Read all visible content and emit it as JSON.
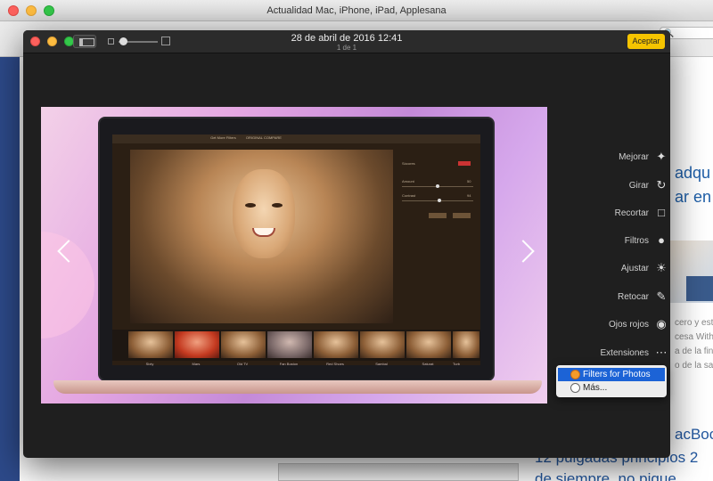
{
  "background_window": {
    "title": "Actualidad Mac, iPhone, iPad, Applesana",
    "right_snippets": [
      "adqu",
      "ar en l"
    ],
    "small_lines": [
      "cero y est",
      "cesa With",
      "a de la fin",
      "o de la sa"
    ],
    "bottom_lines": [
      "acBoo",
      "12 pulgadas principios 2",
      "de siempre, no pique"
    ]
  },
  "editor": {
    "date": "28 de abril de 2016 12:41",
    "count": "1 de 1",
    "accept_label": "Aceptar",
    "tools": [
      {
        "label": "Mejorar",
        "icon": "magic-wand-icon"
      },
      {
        "label": "Girar",
        "icon": "rotate-icon"
      },
      {
        "label": "Recortar",
        "icon": "crop-icon"
      },
      {
        "label": "Filtros",
        "icon": "filters-icon"
      },
      {
        "label": "Ajustar",
        "icon": "adjust-icon"
      },
      {
        "label": "Retocar",
        "icon": "bandage-icon"
      },
      {
        "label": "Ojos rojos",
        "icon": "eye-icon"
      },
      {
        "label": "Extensiones",
        "icon": "ellipsis-icon"
      }
    ],
    "extensions_menu": [
      {
        "label": "Filters for Photos",
        "selected": true
      },
      {
        "label": "Más...",
        "selected": false
      }
    ]
  },
  "photo": {
    "inner_app_title": "Get More Filters",
    "inner_app_header": "ORIGINAL   COMPARE",
    "panel_title": "Sócores",
    "panel_labels": [
      "Amount",
      "Contrast"
    ],
    "panel_values": [
      "50",
      "94"
    ],
    "filmstrip": [
      "Sixty",
      "Mars",
      "Old TV",
      "Fan Boston",
      "Red Shoes",
      "Sambal",
      "Saturat",
      "Turb"
    ]
  }
}
